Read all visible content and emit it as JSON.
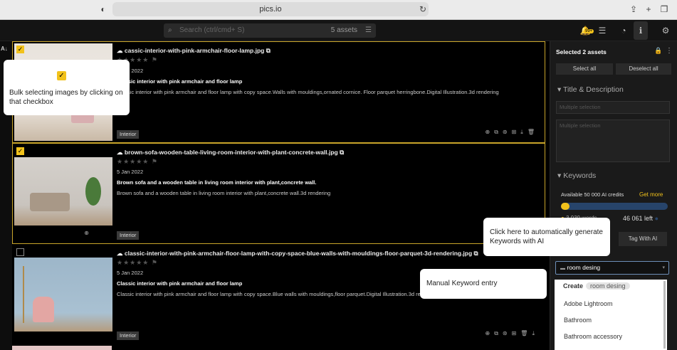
{
  "browser": {
    "url": "pics.io"
  },
  "search": {
    "placeholder": "Search (ctrl/cmd+ S)",
    "count": "5 assets"
  },
  "header": {
    "notif_badge": "99+"
  },
  "assets": [
    {
      "filename": "cassic-interior-with-pink-armchair-floor-lamp.jpg",
      "date": "5 Jan 2022",
      "title": "Classic interior with pink armchair and floor lamp",
      "description": "Classic interior with pink armchair and floor lamp with copy space.Walls with mouldings,ornated cornice. Floor parquet herringbone.Digital Illustration.3d rendering",
      "tag": "Interior",
      "selected": true
    },
    {
      "filename": "brown-sofa-wooden-table-living-room-interior-with-plant-concrete-wall.jpg",
      "date": "5 Jan 2022",
      "title": "Brown sofa and a wooden table in living room interior with plant,concrete wall.",
      "description": "Brown sofa and a wooden table in living room interior with plant,concrete wall.3d rendering",
      "tag": "Interior",
      "selected": true
    },
    {
      "filename": "classic-interior-with-pink-armchair-floor-lamp-with-copy-space-blue-walls-with-mouldings-floor-parquet-3d-rendering.jpg",
      "date": "5 Jan 2022",
      "title": "Classic interior with pink armchair and floor lamp",
      "description": "Classic interior with pink armchair and floor lamp with copy space.Blue walls with mouldings,floor parquet.Digital Illustration.3d rendering",
      "tag": "Interior",
      "selected": false
    }
  ],
  "panel": {
    "selected_label": "Selected 2 assets",
    "select_all": "Select all",
    "deselect_all": "Deselect all",
    "title_desc_header": "Title & Description",
    "title_placeholder": "Multiple selection",
    "desc_placeholder": "Multiple selection",
    "keywords_header": "Keywords",
    "credits_label": "Available 50 000 AI credits",
    "get_more": "Get more",
    "words_used": "3 939 words",
    "left_count": "46 061 left",
    "tag_ai": "Tag With AI",
    "keyword_input": "room desing"
  },
  "dropdown": {
    "create_label": "Create",
    "create_value": "room desing",
    "options": [
      "Adobe Lightroom",
      "Bathroom",
      "Bathroom accessory"
    ]
  },
  "tooltips": {
    "bulk": "Bulk selecting images by clicking on that checkbox",
    "ai": "Click here to automatically generate Keywords with AI",
    "manual": "Manual Keyword entry"
  },
  "colors": {
    "accent": "#f2c21b",
    "tooltip_bg": "#ffffff",
    "panel_bg": "#1a1a1a"
  }
}
